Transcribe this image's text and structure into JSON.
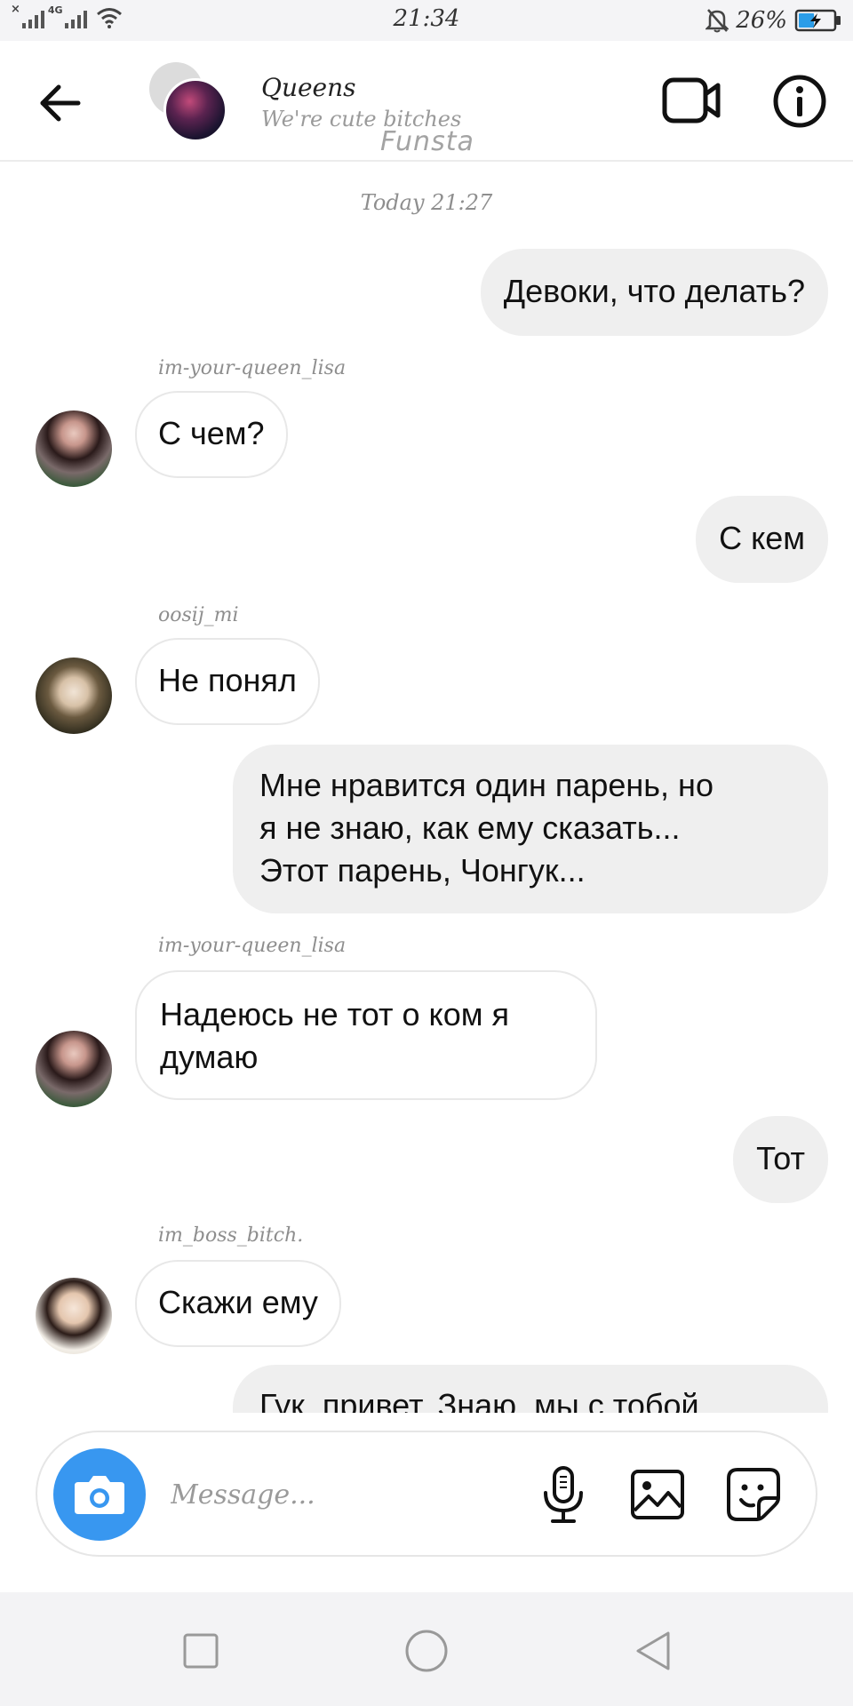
{
  "status_bar": {
    "cross": "×",
    "network": "4G",
    "time": "21:34",
    "battery_percent": "26%",
    "battery_level": 0.26
  },
  "header": {
    "title": "Queens",
    "subtitle": "We're cute bitches",
    "watermark": "Funsta"
  },
  "chat": {
    "timestamp": "Today 21:27",
    "messages": [
      {
        "direction": "out",
        "text": "Девоки, что делать?"
      },
      {
        "direction": "in",
        "sender": "im-your-queen_lisa",
        "avatar": "lisa",
        "text": "С чем?"
      },
      {
        "direction": "out",
        "text": "С кем"
      },
      {
        "direction": "in",
        "sender": "oosij_mi",
        "avatar": "mi",
        "text": "Не понял"
      },
      {
        "direction": "out",
        "lines": [
          "Мне нравится один парень, но",
          "я не знаю, как ему сказать...",
          "Этот парень, Чонгук..."
        ]
      },
      {
        "direction": "in",
        "sender": "im-your-queen_lisa",
        "avatar": "lisa",
        "lines": [
          "Надеюсь не тот о ком я",
          "думаю"
        ]
      },
      {
        "direction": "out",
        "text": "Тот"
      },
      {
        "direction": "in",
        "sender": "im_boss_bitch.",
        "avatar": "boss",
        "text": "Скажи ему"
      },
      {
        "direction": "out",
        "text": "Гук, привет. Знаю, мы с тобой"
      }
    ]
  },
  "composer": {
    "placeholder": "Message...",
    "accent_color": "#3897f0"
  },
  "colors": {
    "outgoing_bubble": "#efefef",
    "incoming_border": "#e8e8e8",
    "muted_text": "#8e8e8e"
  }
}
